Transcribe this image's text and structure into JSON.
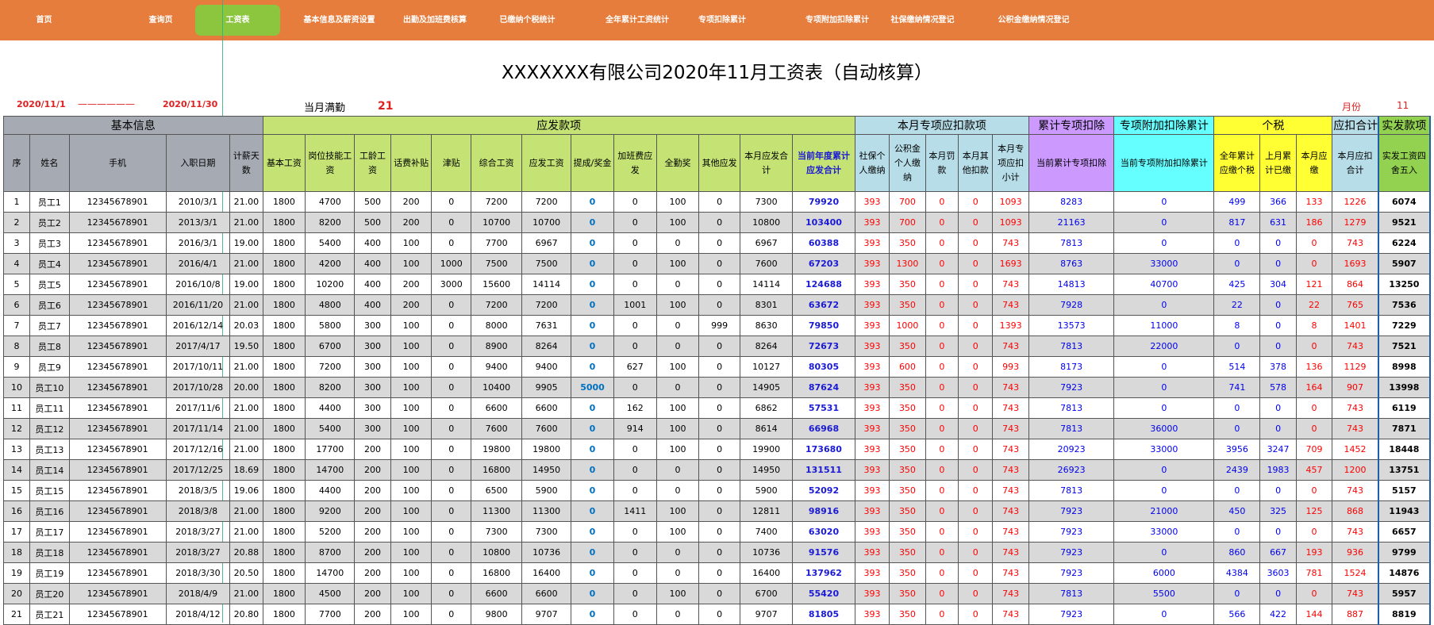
{
  "nav": [
    {
      "label": "首页",
      "active": false
    },
    {
      "label": "查询页",
      "active": false
    },
    {
      "label": "工资表",
      "active": true
    },
    {
      "label": "基本信息及薪资设置",
      "active": false
    },
    {
      "label": "出勤及加班费核算",
      "active": false
    },
    {
      "label": "已缴纳个税统计",
      "active": false
    },
    {
      "label": "全年累计工资统计",
      "active": false
    },
    {
      "label": "专项扣除累计",
      "active": false
    },
    {
      "label": "专项附加扣除累计",
      "active": false
    },
    {
      "label": "社保缴纳情况登记",
      "active": false
    },
    {
      "label": "公积金缴纳情况登记",
      "active": false
    }
  ],
  "title": "XXXXXXX有限公司2020年11月工资表（自动核算）",
  "period": {
    "start": "2020/11/1",
    "sep": "——————",
    "end": "2020/11/30"
  },
  "attendance": {
    "label": "当月满勤",
    "value": "21"
  },
  "month": {
    "label": "月份",
    "value": "11"
  },
  "colors": {
    "nav": "#e77d3c",
    "nav_active": "#8cc63f",
    "basic": "#a6abb3",
    "pay": "#c5e374",
    "deduction": "#b7dde8",
    "cumulative": "#cc99ff",
    "additional": "#66ffff",
    "tax": "#ffff33",
    "net": "#93d150"
  },
  "groups": [
    {
      "label": "基本信息"
    },
    {
      "label": "应发款项"
    },
    {
      "label": "本月专项应扣款项"
    },
    {
      "label": "累计专项扣除"
    },
    {
      "label": "专项附加扣除累计"
    },
    {
      "label": "个税"
    },
    {
      "label": "应扣合计"
    },
    {
      "label": "实发款项"
    }
  ],
  "columns": [
    "序",
    "姓名",
    "手机",
    "入职日期",
    "计薪天数",
    "基本工资",
    "岗位技能工资",
    "工龄工资",
    "话费补贴",
    "津贴",
    "综合工资",
    "应发工资",
    "提成/奖金",
    "加班费应发",
    "全勤奖",
    "其他应发",
    "本月应发合计",
    "当前年度累计应发合计",
    "社保个人缴纳",
    "公积金个人缴纳",
    "本月罚款",
    "本月其他扣款",
    "本月专项应扣小计",
    "当前累计专项扣除",
    "当前专项附加扣除累计",
    "全年累计应缴个税",
    "上月累计已缴",
    "本月应缴",
    "本月应扣合计",
    "实发工资四舍五入"
  ],
  "rows": [
    [
      "1",
      "员工1",
      "12345678901",
      "2010/3/1",
      "21.00",
      "1800",
      "4700",
      "500",
      "200",
      "0",
      "7200",
      "7200",
      "0",
      "0",
      "100",
      "0",
      "7300",
      "79920",
      "393",
      "700",
      "0",
      "0",
      "1093",
      "8283",
      "0",
      "499",
      "366",
      "133",
      "1226",
      "6074"
    ],
    [
      "2",
      "员工2",
      "12345678901",
      "2013/3/1",
      "21.00",
      "1800",
      "8200",
      "500",
      "200",
      "0",
      "10700",
      "10700",
      "0",
      "0",
      "100",
      "0",
      "10800",
      "103400",
      "393",
      "700",
      "0",
      "0",
      "1093",
      "21163",
      "0",
      "817",
      "631",
      "186",
      "1279",
      "9521"
    ],
    [
      "3",
      "员工3",
      "12345678901",
      "2016/3/1",
      "19.00",
      "1800",
      "5400",
      "400",
      "100",
      "0",
      "7700",
      "6967",
      "0",
      "0",
      "0",
      "0",
      "6967",
      "60388",
      "393",
      "350",
      "0",
      "0",
      "743",
      "7813",
      "0",
      "0",
      "0",
      "0",
      "743",
      "6224"
    ],
    [
      "4",
      "员工4",
      "12345678901",
      "2016/4/1",
      "21.00",
      "1800",
      "4200",
      "400",
      "100",
      "1000",
      "7500",
      "7500",
      "0",
      "0",
      "100",
      "0",
      "7600",
      "67203",
      "393",
      "1300",
      "0",
      "0",
      "1693",
      "8763",
      "33000",
      "0",
      "0",
      "0",
      "1693",
      "5907"
    ],
    [
      "5",
      "员工5",
      "12345678901",
      "2016/10/8",
      "19.00",
      "1800",
      "10200",
      "400",
      "200",
      "3000",
      "15600",
      "14114",
      "0",
      "0",
      "0",
      "0",
      "14114",
      "124688",
      "393",
      "350",
      "0",
      "0",
      "743",
      "14813",
      "40700",
      "425",
      "304",
      "121",
      "864",
      "13250"
    ],
    [
      "6",
      "员工6",
      "12345678901",
      "2016/11/20",
      "21.00",
      "1800",
      "4800",
      "400",
      "200",
      "0",
      "7200",
      "7200",
      "0",
      "1001",
      "100",
      "0",
      "8301",
      "63672",
      "393",
      "350",
      "0",
      "0",
      "743",
      "7928",
      "0",
      "22",
      "0",
      "22",
      "765",
      "7536"
    ],
    [
      "7",
      "员工7",
      "12345678901",
      "2016/12/14",
      "20.03",
      "1800",
      "5800",
      "300",
      "100",
      "0",
      "8000",
      "7631",
      "0",
      "0",
      "0",
      "999",
      "8630",
      "79850",
      "393",
      "1000",
      "0",
      "0",
      "1393",
      "13573",
      "11000",
      "8",
      "0",
      "8",
      "1401",
      "7229"
    ],
    [
      "8",
      "员工8",
      "12345678901",
      "2017/4/17",
      "19.50",
      "1800",
      "6700",
      "300",
      "100",
      "0",
      "8900",
      "8264",
      "0",
      "0",
      "0",
      "0",
      "8264",
      "72673",
      "393",
      "350",
      "0",
      "0",
      "743",
      "7813",
      "22000",
      "0",
      "0",
      "0",
      "743",
      "7521"
    ],
    [
      "9",
      "员工9",
      "12345678901",
      "2017/10/11",
      "21.00",
      "1800",
      "7200",
      "300",
      "100",
      "0",
      "9400",
      "9400",
      "0",
      "627",
      "100",
      "0",
      "10127",
      "80305",
      "393",
      "600",
      "0",
      "0",
      "993",
      "8173",
      "0",
      "514",
      "378",
      "136",
      "1129",
      "8998"
    ],
    [
      "10",
      "员工10",
      "12345678901",
      "2017/10/28",
      "20.00",
      "1800",
      "8200",
      "300",
      "100",
      "0",
      "10400",
      "9905",
      "5000",
      "0",
      "0",
      "0",
      "14905",
      "87624",
      "393",
      "350",
      "0",
      "0",
      "743",
      "7923",
      "0",
      "741",
      "578",
      "164",
      "907",
      "13998"
    ],
    [
      "11",
      "员工11",
      "12345678901",
      "2017/11/6",
      "21.00",
      "1800",
      "4400",
      "300",
      "100",
      "0",
      "6600",
      "6600",
      "0",
      "162",
      "100",
      "0",
      "6862",
      "57531",
      "393",
      "350",
      "0",
      "0",
      "743",
      "7813",
      "0",
      "0",
      "0",
      "0",
      "743",
      "6119"
    ],
    [
      "12",
      "员工12",
      "12345678901",
      "2017/11/14",
      "21.00",
      "1800",
      "5400",
      "300",
      "100",
      "0",
      "7600",
      "7600",
      "0",
      "914",
      "100",
      "0",
      "8614",
      "66968",
      "393",
      "350",
      "0",
      "0",
      "743",
      "7813",
      "36000",
      "0",
      "0",
      "0",
      "743",
      "7871"
    ],
    [
      "13",
      "员工13",
      "12345678901",
      "2017/12/16",
      "21.00",
      "1800",
      "17700",
      "200",
      "100",
      "0",
      "19800",
      "19800",
      "0",
      "0",
      "100",
      "0",
      "19900",
      "173680",
      "393",
      "350",
      "0",
      "0",
      "743",
      "20923",
      "33000",
      "3956",
      "3247",
      "709",
      "1452",
      "18448"
    ],
    [
      "14",
      "员工14",
      "12345678901",
      "2017/12/25",
      "18.69",
      "1800",
      "14700",
      "200",
      "100",
      "0",
      "16800",
      "14950",
      "0",
      "0",
      "0",
      "0",
      "14950",
      "131511",
      "393",
      "350",
      "0",
      "0",
      "743",
      "26923",
      "0",
      "2439",
      "1983",
      "457",
      "1200",
      "13751"
    ],
    [
      "15",
      "员工15",
      "12345678901",
      "2018/3/5",
      "19.06",
      "1800",
      "4400",
      "200",
      "100",
      "0",
      "6500",
      "5900",
      "0",
      "0",
      "0",
      "0",
      "5900",
      "52092",
      "393",
      "350",
      "0",
      "0",
      "743",
      "7813",
      "0",
      "0",
      "0",
      "0",
      "743",
      "5157"
    ],
    [
      "16",
      "员工16",
      "12345678901",
      "2018/3/8",
      "21.00",
      "1800",
      "9200",
      "200",
      "100",
      "0",
      "11300",
      "11300",
      "0",
      "1411",
      "100",
      "0",
      "12811",
      "98916",
      "393",
      "350",
      "0",
      "0",
      "743",
      "7923",
      "21000",
      "450",
      "325",
      "125",
      "868",
      "11943"
    ],
    [
      "17",
      "员工17",
      "12345678901",
      "2018/3/27",
      "21.00",
      "1800",
      "5200",
      "200",
      "100",
      "0",
      "7300",
      "7300",
      "0",
      "0",
      "100",
      "0",
      "7400",
      "63020",
      "393",
      "350",
      "0",
      "0",
      "743",
      "7923",
      "33000",
      "0",
      "0",
      "0",
      "743",
      "6657"
    ],
    [
      "18",
      "员工18",
      "12345678901",
      "2018/3/27",
      "20.88",
      "1800",
      "8700",
      "200",
      "100",
      "0",
      "10800",
      "10736",
      "0",
      "0",
      "0",
      "0",
      "10736",
      "91576",
      "393",
      "350",
      "0",
      "0",
      "743",
      "7923",
      "0",
      "860",
      "667",
      "193",
      "936",
      "9799"
    ],
    [
      "19",
      "员工19",
      "12345678901",
      "2018/3/30",
      "20.50",
      "1800",
      "14700",
      "200",
      "100",
      "0",
      "16800",
      "16400",
      "0",
      "0",
      "0",
      "0",
      "16400",
      "137962",
      "393",
      "350",
      "0",
      "0",
      "743",
      "7923",
      "6000",
      "4384",
      "3603",
      "781",
      "1524",
      "14876"
    ],
    [
      "20",
      "员工20",
      "12345678901",
      "2018/4/9",
      "21.00",
      "1800",
      "4500",
      "200",
      "100",
      "0",
      "6600",
      "6600",
      "0",
      "0",
      "100",
      "0",
      "6700",
      "55420",
      "393",
      "350",
      "0",
      "0",
      "743",
      "7813",
      "5500",
      "0",
      "0",
      "0",
      "743",
      "5957"
    ],
    [
      "21",
      "员工21",
      "12345678901",
      "2018/4/12",
      "20.80",
      "1800",
      "7700",
      "200",
      "100",
      "0",
      "9800",
      "9707",
      "0",
      "0",
      "0",
      "0",
      "9707",
      "81805",
      "393",
      "350",
      "0",
      "0",
      "743",
      "7923",
      "0",
      "566",
      "422",
      "144",
      "887",
      "8819"
    ]
  ]
}
